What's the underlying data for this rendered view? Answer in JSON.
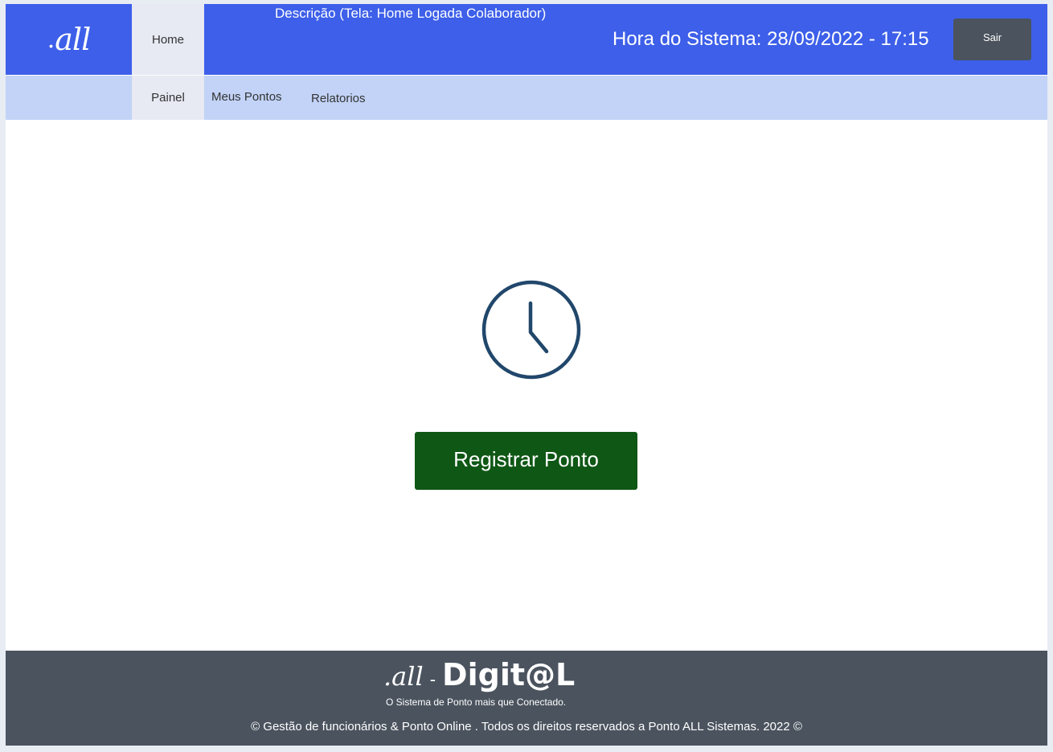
{
  "header": {
    "logo_text": "all",
    "home_tab": "Home",
    "description": "Descrição (Tela:  Home Logada Colaborador)",
    "system_time": "Hora do Sistema: 28/09/2022  -  17:15",
    "exit_label": "Sair"
  },
  "subnav": {
    "items": [
      {
        "label": "Painel",
        "active": true
      },
      {
        "label": "Meus Pontos",
        "active": false
      },
      {
        "label": "Relatorios",
        "active": false
      }
    ]
  },
  "main": {
    "icon": "clock-icon",
    "register_label": "Registrar Ponto"
  },
  "footer": {
    "brand_all": ".all",
    "brand_sep": "-",
    "brand_digital": "Digit@L",
    "tagline": "O Sistema de Ponto mais que Conectado.",
    "copyright": "© Gestão de funcionários & Ponto Online .  Todos os direitos reservados a Ponto ALL Sistemas.   2022 ©"
  },
  "colors": {
    "header_bg": "#3d5fe9",
    "subnav_bg": "#c2d3f7",
    "active_tab_bg": "#e7e9f3",
    "register_btn": "#0f5715",
    "footer_bg": "#4a535e",
    "clock_stroke": "#21476b"
  }
}
